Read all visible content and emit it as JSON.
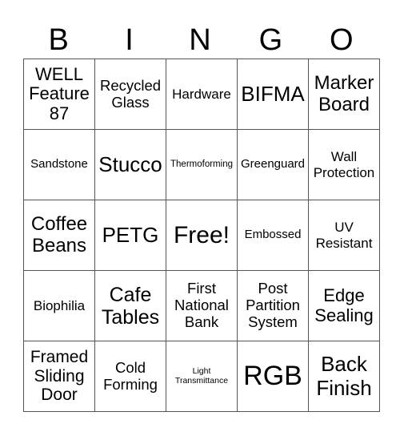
{
  "header": {
    "letters": [
      "B",
      "I",
      "N",
      "G",
      "O"
    ]
  },
  "board": {
    "rows": [
      [
        "WELL Feature 87",
        "Recycled Glass",
        "Hardware",
        "BIFMA",
        "Marker Board"
      ],
      [
        "Sandstone",
        "Stucco",
        "Thermoforming",
        "Greenguard",
        "Wall Protection"
      ],
      [
        "Coffee Beans",
        "PETG",
        "Free!",
        "Embossed",
        "UV Resistant"
      ],
      [
        "Biophilia",
        "Cafe Tables",
        "First National Bank",
        "Post Partition System",
        "Edge Sealing"
      ],
      [
        "Framed Sliding Door",
        "Cold Forming",
        "Light Transmittance",
        "RGB",
        "Back Finish"
      ]
    ]
  },
  "colors": {
    "background": "#ffffff",
    "text": "#000000",
    "grid_line": "#555555"
  }
}
